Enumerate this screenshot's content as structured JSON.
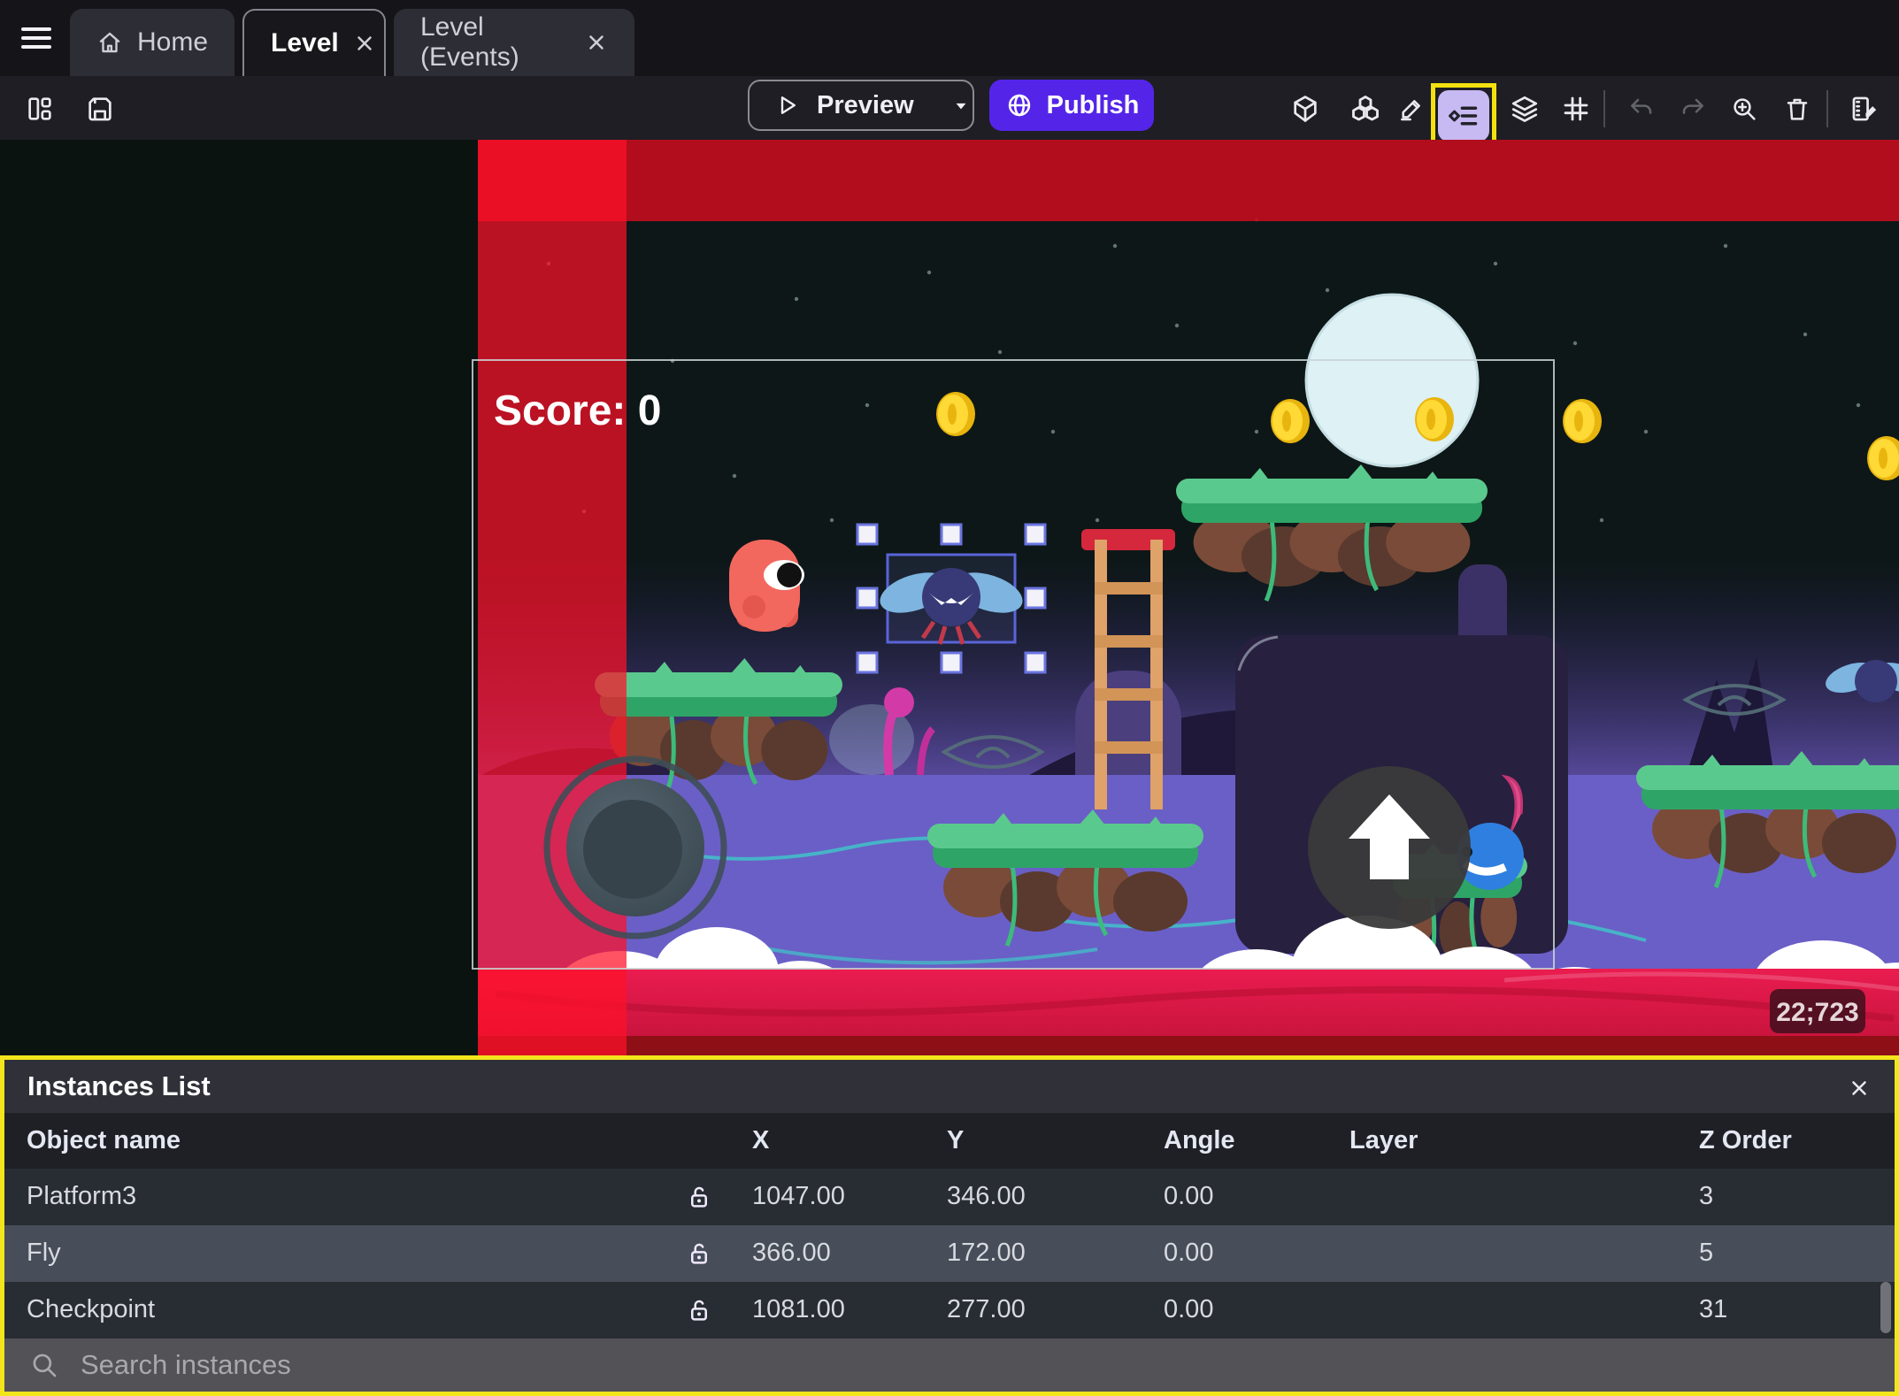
{
  "tab_bar": {
    "tabs": [
      {
        "id": "home",
        "label": "Home",
        "icon": "home",
        "closable": false,
        "active": false
      },
      {
        "id": "level",
        "label": "Level",
        "icon": null,
        "closable": true,
        "active": true
      },
      {
        "id": "events",
        "label": "Level (Events)",
        "icon": null,
        "closable": true,
        "active": false
      }
    ]
  },
  "toolbar": {
    "preview_label": "Preview",
    "publish_label": "Publish",
    "left_icons": [
      "layout-icon",
      "save-icon"
    ],
    "right_icons": [
      "cube-3d-icon",
      "objects-icon",
      "pencil-icon",
      "instances-list-icon (highlighted)",
      "layers-icon",
      "grid-icon",
      "undo-icon",
      "redo-icon",
      "zoom-in-icon",
      "trash-icon",
      "scene-events-edit-icon"
    ]
  },
  "scene": {
    "score_text": "Score: 0",
    "coords_badge": "22;723",
    "selected_object": "Fly"
  },
  "instances_panel": {
    "title": "Instances List",
    "columns": {
      "name": "Object name",
      "x": "X",
      "y": "Y",
      "angle": "Angle",
      "layer": "Layer",
      "z": "Z Order"
    },
    "rows": [
      {
        "name": "Platform3",
        "locked": false,
        "x": "1047.00",
        "y": "346.00",
        "angle": "0.00",
        "layer": "",
        "z": "3",
        "selected": false
      },
      {
        "name": "Fly",
        "locked": false,
        "x": "366.00",
        "y": "172.00",
        "angle": "0.00",
        "layer": "",
        "z": "5",
        "selected": true
      },
      {
        "name": "Checkpoint",
        "locked": false,
        "x": "1081.00",
        "y": "277.00",
        "angle": "0.00",
        "layer": "",
        "z": "31",
        "selected": false
      }
    ],
    "search_placeholder": "Search instances"
  },
  "colors": {
    "publish_purple": "#5425e8",
    "highlight_yellow": "#f2e51b",
    "selection_blue": "#5a64d8",
    "danger_red_stripe": "#e11432",
    "instances_icon_bg": "#c7b9f2"
  }
}
